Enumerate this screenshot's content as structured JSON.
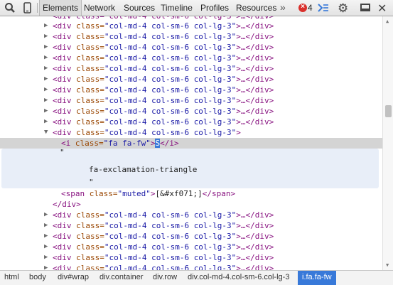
{
  "toolbar": {
    "tabs": [
      "Elements",
      "Network",
      "Sources",
      "Timeline",
      "Profiles",
      "Resources"
    ],
    "overflow": "»",
    "error_count": "4",
    "error_symbol": "×",
    "icons": [
      "search-icon",
      "device-mode-icon",
      "console-icon",
      "gear-icon",
      "dock-icon",
      "close-icon"
    ]
  },
  "tree": {
    "triangle_closed": "▶",
    "triangle_open": "▼",
    "tag_open": "<div",
    "attr_class": " class=",
    "class_col": "\"col-md-4 col-sm-6 col-lg-3\"",
    "tail_collapsed": ">…</div>",
    "tail_open": ">",
    "partial_line": "<div class=\"col-md-4 col-sm-6 col-lg-3\">…</div>",
    "i_open": "<i",
    "i_class": "\"fa fa-fw\"",
    "i_mid": ">",
    "i_cursor": "S",
    "i_close": "</i>",
    "text_quote_open": "\"",
    "text_value": "fa-exclamation-triangle",
    "text_quote_close": "\"",
    "span_open": "<span",
    "span_class": "\"muted\"",
    "span_text": "[&#xf071;]",
    "span_close": "</span>",
    "div_close": "</div>"
  },
  "breadcrumbs": [
    "html",
    "body",
    "div#wrap",
    "div.container",
    "div.row",
    "div.col-md-4.col-sm-6.col-lg-3",
    "i.fa.fa-fw"
  ],
  "colors": {
    "tag": "#881280",
    "attr": "#994500",
    "value": "#1a1aa6",
    "selection": "#3879d9"
  }
}
